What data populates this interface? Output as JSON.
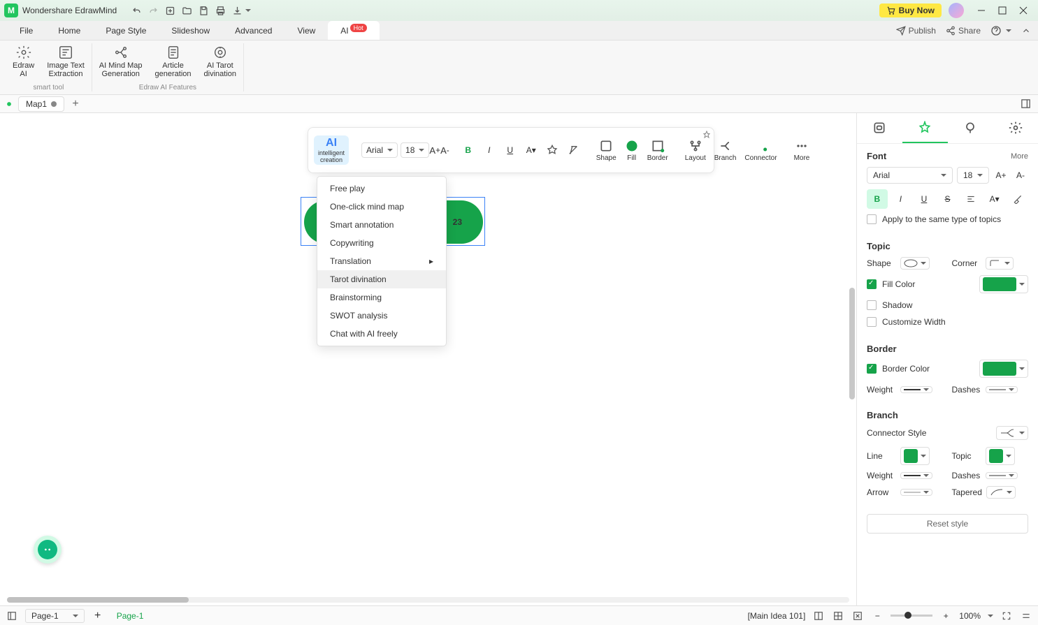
{
  "app": {
    "title": "Wondershare EdrawMind",
    "buy": "Buy Now",
    "publish": "Publish",
    "share": "Share"
  },
  "menu": {
    "items": [
      "File",
      "Home",
      "Page Style",
      "Slideshow",
      "Advanced",
      "View",
      "AI"
    ],
    "hot": "Hot"
  },
  "ribbon": {
    "group1_label": "smart tool",
    "group2_label": "Edraw AI Features",
    "btns": [
      "Edraw\nAI",
      "Image Text\nExtraction",
      "AI Mind Map\nGeneration",
      "Article\ngeneration",
      "AI Tarot\ndivination"
    ]
  },
  "doc_tab": "Map1",
  "float": {
    "ai": "AI",
    "ai_lbl": "intelligent\ncreation",
    "font": "Arial",
    "size": "18",
    "tools": [
      "Shape",
      "Fill",
      "Border",
      "Layout",
      "Branch",
      "Connector",
      "More"
    ]
  },
  "ai_menu": [
    "Free play",
    "One-click mind map",
    "Smart annotation",
    "Copywriting",
    "Translation",
    "Tarot divination",
    "Brainstorming",
    "SWOT analysis",
    "Chat with AI freely"
  ],
  "node_text": "23",
  "panel": {
    "font": {
      "head": "Font",
      "more": "More",
      "name": "Arial",
      "size": "18",
      "apply": "Apply to the same type of topics"
    },
    "topic": {
      "head": "Topic",
      "shape": "Shape",
      "corner": "Corner",
      "fill": "Fill Color",
      "shadow": "Shadow",
      "custom": "Customize Width"
    },
    "border": {
      "head": "Border",
      "color": "Border Color",
      "weight": "Weight",
      "dashes": "Dashes"
    },
    "branch": {
      "head": "Branch",
      "connector": "Connector Style",
      "line": "Line",
      "topic": "Topic",
      "weight": "Weight",
      "dashes": "Dashes",
      "arrow": "Arrow",
      "tapered": "Tapered"
    },
    "reset": "Reset style",
    "fill_color": "#16a34a",
    "line_color": "#16a34a"
  },
  "status": {
    "page_sel": "Page-1",
    "page_tab": "Page-1",
    "cursor": "[Main Idea 101]",
    "zoom": "100%"
  }
}
